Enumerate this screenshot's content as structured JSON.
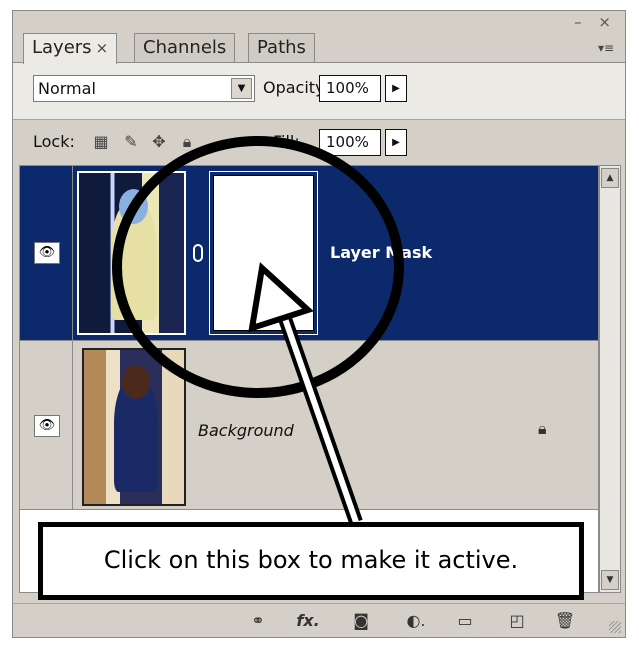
{
  "window": {
    "controls": "– ×",
    "flyout_icon": "menu-flyout"
  },
  "tabs": [
    {
      "label": "Layers",
      "close": "×"
    },
    {
      "label": "Channels"
    },
    {
      "label": "Paths"
    }
  ],
  "options": {
    "blend_mode": "Normal",
    "opacity_label": "Opacity:",
    "opacity_value": "100%",
    "lock_label": "Lock:",
    "fill_label": "Fill:",
    "fill_value": "100%"
  },
  "layers": [
    {
      "name": "Layer Mask",
      "selected": true,
      "visible": true,
      "has_mask": true
    },
    {
      "name": "Background",
      "selected": false,
      "visible": true,
      "locked": true
    }
  ],
  "bottom_toolbar": [
    "link-layers-icon",
    "fx-icon",
    "add-mask-icon",
    "adjustment-icon",
    "new-group-icon",
    "new-layer-icon",
    "trash-icon"
  ],
  "annotation": {
    "text": "Click on this box to make it active."
  },
  "colors": {
    "selection": "#0c2a6b",
    "panel": "#d4d0c8"
  }
}
